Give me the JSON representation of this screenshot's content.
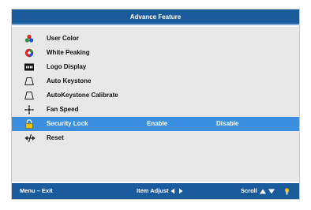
{
  "title": "Advance Feature",
  "menu": {
    "items": [
      {
        "label": "User Color",
        "icon": "user-color-icon"
      },
      {
        "label": "White Peaking",
        "icon": "white-peaking-icon"
      },
      {
        "label": "Logo Display",
        "icon": "logo-display-icon"
      },
      {
        "label": "Auto Keystone",
        "icon": "auto-keystone-icon"
      },
      {
        "label": "AutoKeystone Calibrate",
        "icon": "keystone-calibrate-icon"
      },
      {
        "label": "Fan Speed",
        "icon": "fan-speed-icon"
      },
      {
        "label": "Security Lock",
        "icon": "lock-icon",
        "option1": "Enable",
        "option2": "Disable",
        "selected": true
      },
      {
        "label": "Reset",
        "icon": "reset-icon"
      }
    ]
  },
  "footer": {
    "exit_label": "Menu – Exit",
    "adjust_label": "Item Adjust",
    "scroll_label": "Scroll"
  },
  "colors": {
    "title_bar": "#1a5b9d",
    "menu_bg": "#e8e8e8",
    "selected_bg": "#3a8fe0"
  }
}
